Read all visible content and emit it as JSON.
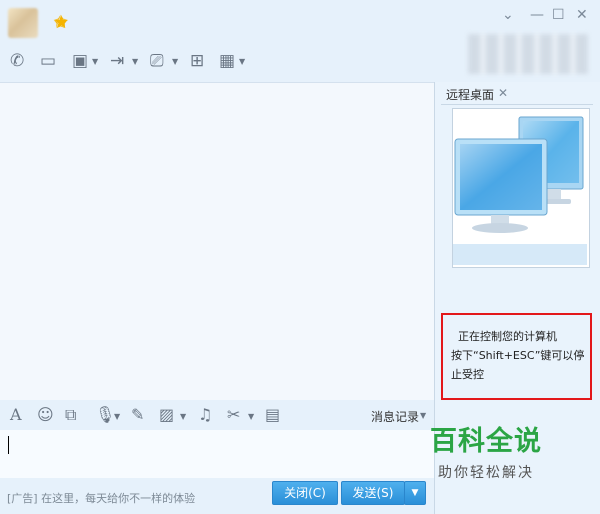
{
  "window": {
    "star_icon": "star-icon",
    "controls": [
      "chevron-down-icon",
      "minimize-icon",
      "maximize-icon",
      "close-icon"
    ]
  },
  "toolbar": {
    "icons": [
      "phone-icon",
      "video-icon",
      "screen-share-icon",
      "file-transfer-icon",
      "remote-desktop-icon",
      "new-chat-icon",
      "apps-icon"
    ]
  },
  "side_panel": {
    "tab_label": "远程桌面",
    "notice_lines": [
      "正在控制您的计算机",
      "按下“Shift+ESC”键可以停",
      "止受控"
    ]
  },
  "input_toolbar": {
    "icons": [
      "font-icon",
      "emoji-icon",
      "shake-icon",
      "voice-icon",
      "pen-icon",
      "image-icon",
      "music-icon",
      "scissors-icon",
      "clipboard-icon"
    ],
    "message_record": "消息记录"
  },
  "footer": {
    "ad_text": "[广告] 在这里，每天给你不一样的体验",
    "close_button": "关闭(C)",
    "send_button": "发送(S)"
  },
  "watermark": {
    "title": "百科全说",
    "subtitle": "助你轻松解决"
  }
}
